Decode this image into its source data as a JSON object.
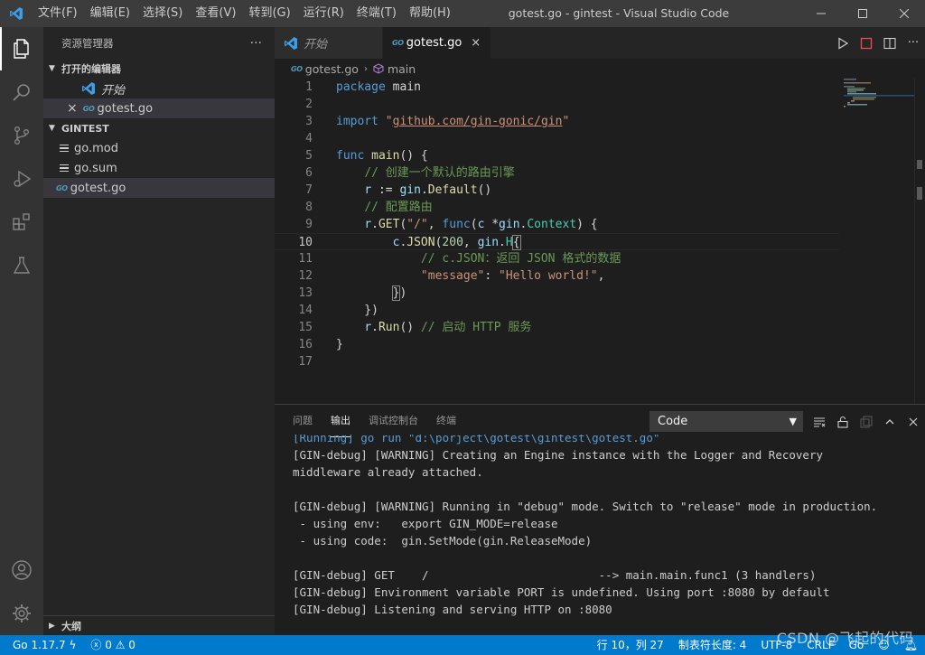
{
  "titlebar": {
    "menu": [
      "文件(F)",
      "编辑(E)",
      "选择(S)",
      "查看(V)",
      "转到(G)",
      "运行(R)",
      "终端(T)",
      "帮助(H)"
    ],
    "window_title": "gotest.go - gintest - Visual Studio Code"
  },
  "sidebar": {
    "header": "资源管理器",
    "more": "···",
    "open_editors_title": "打开的编辑器",
    "open_editors": [
      {
        "label": "开始",
        "icon": "vscode-icon"
      },
      {
        "label": "gotest.go",
        "icon": "go-file-icon",
        "close": "×"
      }
    ],
    "folder_title": "GINTEST",
    "files": [
      {
        "label": "go.mod",
        "icon": "lines-icon"
      },
      {
        "label": "go.sum",
        "icon": "lines-icon"
      },
      {
        "label": "gotest.go",
        "icon": "go-file-icon"
      }
    ],
    "outline_title": "大纲",
    "go_badge": "GO"
  },
  "tabs": [
    {
      "label": "开始"
    },
    {
      "label": "gotest.go",
      "close": "×"
    }
  ],
  "breadcrumb": {
    "file": "gotest.go",
    "symbol": "main"
  },
  "editor": {
    "current_line": 10,
    "lines": [
      "package main",
      "",
      "import \"github.com/gin-gonic/gin\"",
      "",
      "func main() {",
      "    // 创建一个默认的路由引擎",
      "    r := gin.Default()",
      "    // 配置路由",
      "    r.GET(\"/\", func(c *gin.Context) {",
      "        c.JSON(200, gin.H{",
      "            // c.JSON：返回 JSON 格式的数据",
      "            \"message\": \"Hello world!\",",
      "        })",
      "    })",
      "    r.Run() // 启动 HTTP 服务",
      "}",
      ""
    ]
  },
  "panel": {
    "tabs": [
      "问题",
      "输出",
      "调试控制台",
      "终端"
    ],
    "active_tab": "输出",
    "channel": "Code",
    "output": [
      "[Running] go run \"d:\\porject\\gotest\\gintest\\gotest.go\"",
      "[GIN-debug] [WARNING] Creating an Engine instance with the Logger and Recovery",
      "middleware already attached.",
      "",
      "[GIN-debug] [WARNING] Running in \"debug\" mode. Switch to \"release\" mode in production.",
      " - using env:   export GIN_MODE=release",
      " - using code:  gin.SetMode(gin.ReleaseMode)",
      "",
      "[GIN-debug] GET    /                         --> main.main.func1 (3 handlers)",
      "[GIN-debug] Environment variable PORT is undefined. Using port :8080 by default",
      "[GIN-debug] Listening and serving HTTP on :8080"
    ]
  },
  "statusbar": {
    "go_version": "Go 1.17.7",
    "errors": "0",
    "warnings": "0",
    "cursor": "行 10，列 27",
    "tab_size": "制表符长度: 4",
    "encoding": "UTF-8",
    "eol": "CRLF",
    "language": "Go"
  },
  "watermark": "CSDN @飞起的代码",
  "colors": {
    "accent": "#007acc",
    "go": "#519aba",
    "keyword": "#569cd6",
    "string": "#ce9178",
    "comment": "#6a9955"
  }
}
